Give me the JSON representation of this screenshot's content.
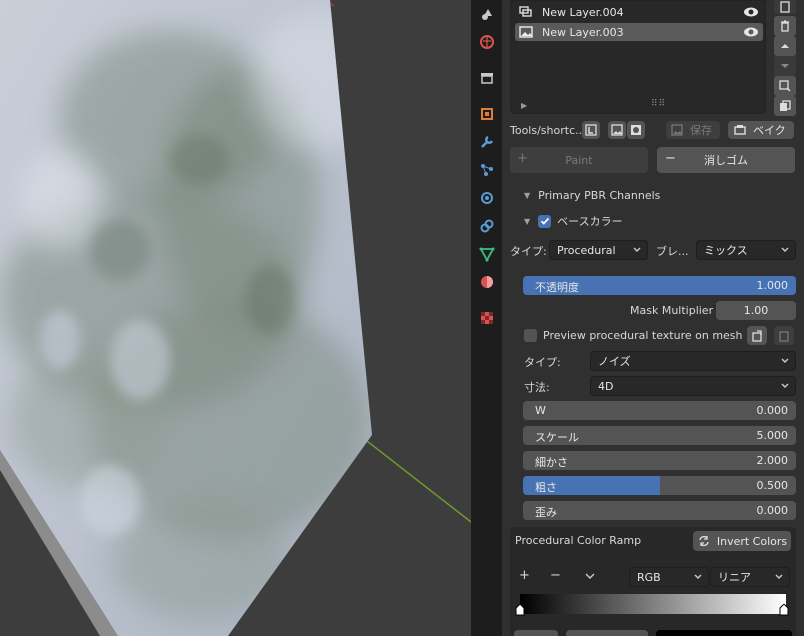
{
  "layers": [
    {
      "name": "New Layer.004",
      "active": false
    },
    {
      "name": "New Layer.003",
      "active": true
    }
  ],
  "tools_label": "Tools/shortc...",
  "save_label": "保存",
  "bake_label": "ベイク",
  "paint_label": "Paint",
  "erase_label": "消しゴム",
  "primary_pbr_label": "Primary PBR Channels",
  "base_color_label": "ベースカラー",
  "type_label": "タイプ:",
  "type_value": "Procedural",
  "blend_label": "ブレ...",
  "blend_value": "ミックス",
  "opacity": {
    "label": "不透明度",
    "value": "1.000",
    "fraction": 1.0
  },
  "mask_multiplier": {
    "label": "Mask Multiplier",
    "value": "1.00"
  },
  "preview_label": "Preview procedural texture on mesh",
  "noise_type_label": "タイプ:",
  "noise_type_value": "ノイズ",
  "dimension_label": "寸法:",
  "dimension_value": "4D",
  "w": {
    "label": "W",
    "value": "0.000",
    "fraction": 0.0
  },
  "scale": {
    "label": "スケール",
    "value": "5.000",
    "fraction": 0.0
  },
  "detail": {
    "label": "細かさ",
    "value": "2.000",
    "fraction": 0.0
  },
  "roughness": {
    "label": "粗さ",
    "value": "0.500",
    "fraction": 0.5
  },
  "distortion": {
    "label": "歪み",
    "value": "0.000",
    "fraction": 0.0
  },
  "color_ramp_label": "Procedural Color Ramp",
  "invert_colors_label": "Invert Colors",
  "ramp_add": "+",
  "ramp_remove": "−",
  "color_mode_value": "RGB",
  "interpolation_value": "リニア",
  "colors": {
    "accent": "#4772b3",
    "panel": "#303030",
    "button": "#545454",
    "field": "#282828"
  }
}
